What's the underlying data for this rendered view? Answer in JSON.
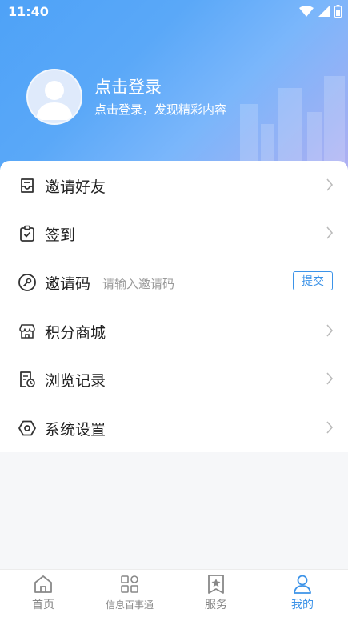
{
  "status_bar": {
    "time": "11:40"
  },
  "profile": {
    "title": "点击登录",
    "subtitle": "点击登录，发现精彩内容"
  },
  "menu": {
    "invite_friends": "邀请好友",
    "sign_in": "签到",
    "invite_code": {
      "label": "邀请码",
      "placeholder": "请输入邀请码",
      "submit": "提交"
    },
    "points_mall": "积分商城",
    "history": "浏览记录",
    "settings": "系统设置"
  },
  "tabs": [
    {
      "label": "首页",
      "icon": "home-icon",
      "active": false
    },
    {
      "label": "信息百事通",
      "icon": "grid-icon",
      "active": false
    },
    {
      "label": "服务",
      "icon": "star-bookmark-icon",
      "active": false
    },
    {
      "label": "我的",
      "icon": "user-icon",
      "active": true
    }
  ],
  "colors": {
    "accent": "#3c93e8",
    "header_start": "#4ea2f7",
    "header_end": "#b7b1f2"
  }
}
